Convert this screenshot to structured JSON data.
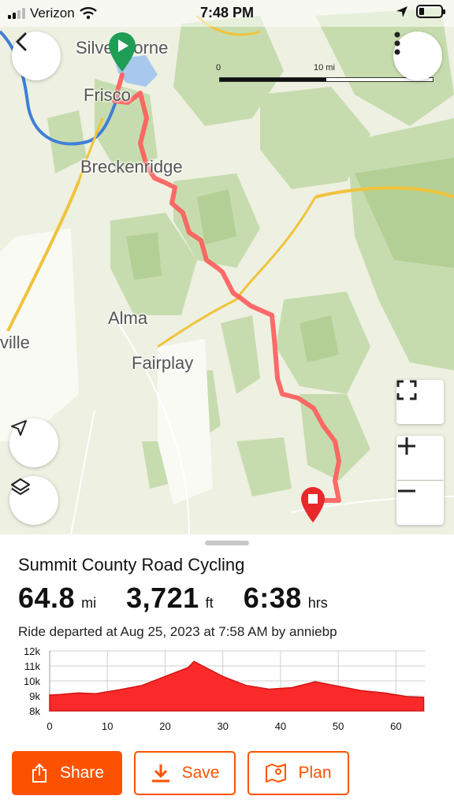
{
  "status_bar": {
    "carrier": "Verizon",
    "time": "7:48 PM"
  },
  "map": {
    "towns": [
      "Silverthorne",
      "Frisco",
      "Breckenridge",
      "Alma",
      "Fairplay",
      "ville"
    ],
    "scale": {
      "start": "0",
      "mid": "10 mi",
      "end": "mi"
    },
    "icons": {
      "back": "chevron-left-icon",
      "more": "more-vertical-icon",
      "locate": "navigation-arrow-icon",
      "layers": "layers-icon",
      "fullscreen": "fullscreen-icon",
      "zoom_in": "plus-icon",
      "zoom_out": "minus-icon",
      "start": "play-marker-icon",
      "end": "stop-marker-icon"
    }
  },
  "route": {
    "title": "Summit County Road Cycling",
    "distance": {
      "value": "64.8",
      "unit": "mi"
    },
    "elevation": {
      "value": "3,721",
      "unit": "ft"
    },
    "time": {
      "value": "6:38",
      "unit": "hrs"
    },
    "departed": "Ride departed at Aug 25, 2023 at 7:58 AM by anniebp"
  },
  "chart_data": {
    "type": "area",
    "x": [
      0,
      2,
      5,
      8,
      12,
      16,
      20,
      24,
      25,
      26,
      30,
      34,
      38,
      42,
      46,
      50,
      54,
      58,
      62,
      64.8
    ],
    "y": [
      9050,
      9100,
      9200,
      9150,
      9400,
      9700,
      10300,
      10900,
      11300,
      11100,
      10300,
      9700,
      9450,
      9550,
      9950,
      9650,
      9350,
      9200,
      8950,
      8900
    ],
    "xticks": [
      "0",
      "10",
      "20",
      "30",
      "40",
      "50",
      "60"
    ],
    "yticks": [
      "12k",
      "11k",
      "10k",
      "9k",
      "8k"
    ],
    "xlim": [
      0,
      65
    ],
    "ylim": [
      8000,
      12000
    ],
    "grid": true,
    "colors": {
      "fill": "#fb2a2a",
      "line": "#d11414"
    }
  },
  "actions": {
    "share": "Share",
    "save": "Save",
    "plan": "Plan"
  },
  "colors": {
    "brand": "#fc5200",
    "route": "#ff5b5b",
    "start": "#1f9d55",
    "end": "#e8282b"
  }
}
